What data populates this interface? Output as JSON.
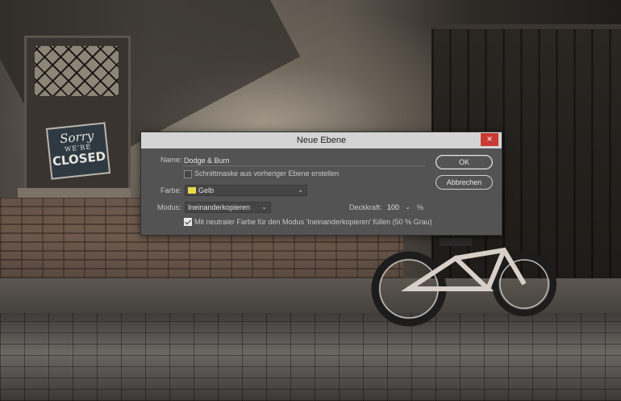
{
  "background": {
    "sign": {
      "line1": "Sorry",
      "line2": "WE'RE",
      "line3": "CLOSED"
    }
  },
  "dialog": {
    "title": "Neue Ebene",
    "close_icon": "×",
    "name_label": "Name:",
    "name_value": "Dodge & Burn",
    "clipping_mask_label": "Schnittmaske aus vorheriger Ebene erstellen",
    "clipping_mask_checked": false,
    "color_label": "Farbe:",
    "color_value": "Gelb",
    "color_swatch": "#e6d84a",
    "mode_label": "Modus:",
    "mode_value": "Ineinanderkopieren",
    "opacity_label": "Deckkraft:",
    "opacity_value": "100",
    "opacity_unit": "%",
    "fill_neutral_label": "Mit neutraler Farbe für den Modus 'Ineinanderkopieren' füllen (50 % Grau)",
    "fill_neutral_checked": true,
    "ok_label": "OK",
    "cancel_label": "Abbrechen"
  },
  "colors": {
    "dialog_bg": "#535353",
    "titlebar_bg": "#d4d4d4",
    "close_bg": "#c83a32"
  }
}
